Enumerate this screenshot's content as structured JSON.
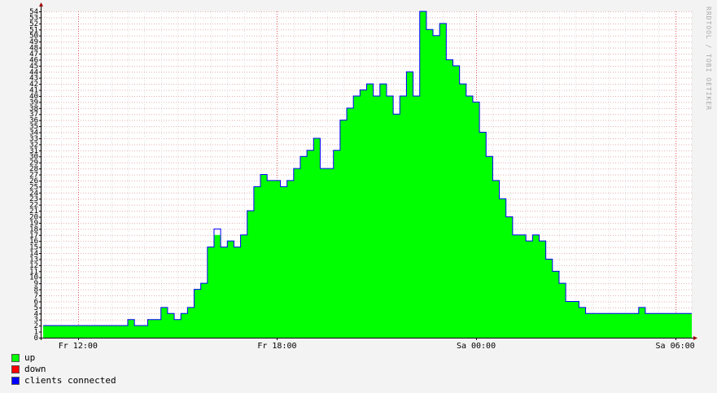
{
  "watermark": "RRDTOOL / TOBI OETIKER",
  "chart_data": {
    "type": "area",
    "ylim": [
      0,
      54
    ],
    "y_ticks": [
      0,
      1,
      2,
      3,
      4,
      5,
      6,
      7,
      8,
      9,
      10,
      11,
      12,
      13,
      14,
      15,
      16,
      17,
      18,
      19,
      20,
      21,
      22,
      23,
      24,
      25,
      26,
      27,
      28,
      29,
      30,
      31,
      32,
      33,
      34,
      35,
      36,
      37,
      38,
      39,
      40,
      41,
      42,
      43,
      44,
      45,
      46,
      47,
      48,
      49,
      50,
      51,
      52,
      53,
      54
    ],
    "x_hour_range": [
      10.9,
      30.5
    ],
    "x_ticks": [
      {
        "hour": 12,
        "label": "Fr 12:00"
      },
      {
        "hour": 18,
        "label": "Fr 18:00"
      },
      {
        "hour": 24,
        "label": "Sa 00:00"
      },
      {
        "hour": 30,
        "label": "Sa 06:00"
      }
    ],
    "grid": true,
    "legend_position": "bottom-left",
    "series": [
      {
        "name": "up",
        "color": "#00ff00",
        "fill": true
      },
      {
        "name": "down",
        "color": "#ff0000",
        "fill": false
      },
      {
        "name": "clients connected",
        "color": "#0000ff",
        "fill": false
      }
    ],
    "x_hours": [
      10.95,
      11.1,
      11.3,
      11.5,
      11.7,
      11.9,
      12.1,
      12.3,
      12.5,
      12.7,
      12.9,
      13.1,
      13.3,
      13.5,
      13.7,
      13.9,
      14.1,
      14.3,
      14.5,
      14.7,
      14.9,
      15.1,
      15.3,
      15.5,
      15.7,
      15.9,
      16.1,
      16.3,
      16.5,
      16.7,
      16.9,
      17.1,
      17.3,
      17.5,
      17.7,
      17.9,
      18.1,
      18.3,
      18.5,
      18.7,
      18.9,
      19.1,
      19.3,
      19.5,
      19.7,
      19.9,
      20.1,
      20.3,
      20.5,
      20.7,
      20.9,
      21.1,
      21.3,
      21.5,
      21.7,
      21.9,
      22.1,
      22.3,
      22.5,
      22.7,
      22.9,
      23.1,
      23.3,
      23.5,
      23.7,
      23.9,
      24.1,
      24.3,
      24.5,
      24.7,
      24.9,
      25.1,
      25.3,
      25.5,
      25.7,
      25.9,
      26.1,
      26.3,
      26.5,
      26.7,
      26.9,
      27.1,
      27.3,
      27.5,
      27.7,
      27.9,
      28.1,
      28.3,
      28.5,
      28.7,
      28.9,
      29.1,
      29.3,
      29.5,
      29.7,
      29.9,
      30.1,
      30.3,
      30.5
    ],
    "up_values": [
      2,
      2,
      2,
      2,
      2,
      2,
      2,
      2,
      2,
      2,
      2,
      2,
      2,
      3,
      2,
      2,
      3,
      3,
      5,
      4,
      3,
      4,
      5,
      8,
      9,
      15,
      17,
      15,
      16,
      15,
      17,
      21,
      25,
      27,
      26,
      26,
      25,
      26,
      28,
      30,
      31,
      33,
      28,
      28,
      31,
      36,
      38,
      40,
      41,
      42,
      40,
      42,
      40,
      37,
      40,
      44,
      40,
      54,
      51,
      50,
      52,
      46,
      45,
      42,
      40,
      39,
      34,
      30,
      26,
      23,
      20,
      17,
      17,
      16,
      17,
      16,
      13,
      11,
      9,
      6,
      6,
      5,
      4,
      4,
      4,
      4,
      4,
      4,
      4,
      4,
      5,
      4,
      4,
      4,
      4,
      4,
      4,
      4,
      4
    ],
    "clients_values": [
      2,
      2,
      2,
      2,
      2,
      2,
      2,
      2,
      2,
      2,
      2,
      2,
      2,
      3,
      2,
      2,
      3,
      3,
      5,
      4,
      3,
      4,
      5,
      8,
      9,
      15,
      18,
      15,
      16,
      15,
      17,
      21,
      25,
      27,
      26,
      26,
      25,
      26,
      28,
      30,
      31,
      33,
      28,
      28,
      31,
      36,
      38,
      40,
      41,
      42,
      40,
      42,
      40,
      37,
      40,
      44,
      40,
      54,
      51,
      50,
      52,
      46,
      45,
      42,
      40,
      39,
      34,
      30,
      26,
      23,
      20,
      17,
      17,
      16,
      17,
      16,
      13,
      11,
      9,
      6,
      6,
      5,
      4,
      4,
      4,
      4,
      4,
      4,
      4,
      4,
      5,
      4,
      4,
      4,
      4,
      4,
      4,
      4,
      4
    ]
  }
}
